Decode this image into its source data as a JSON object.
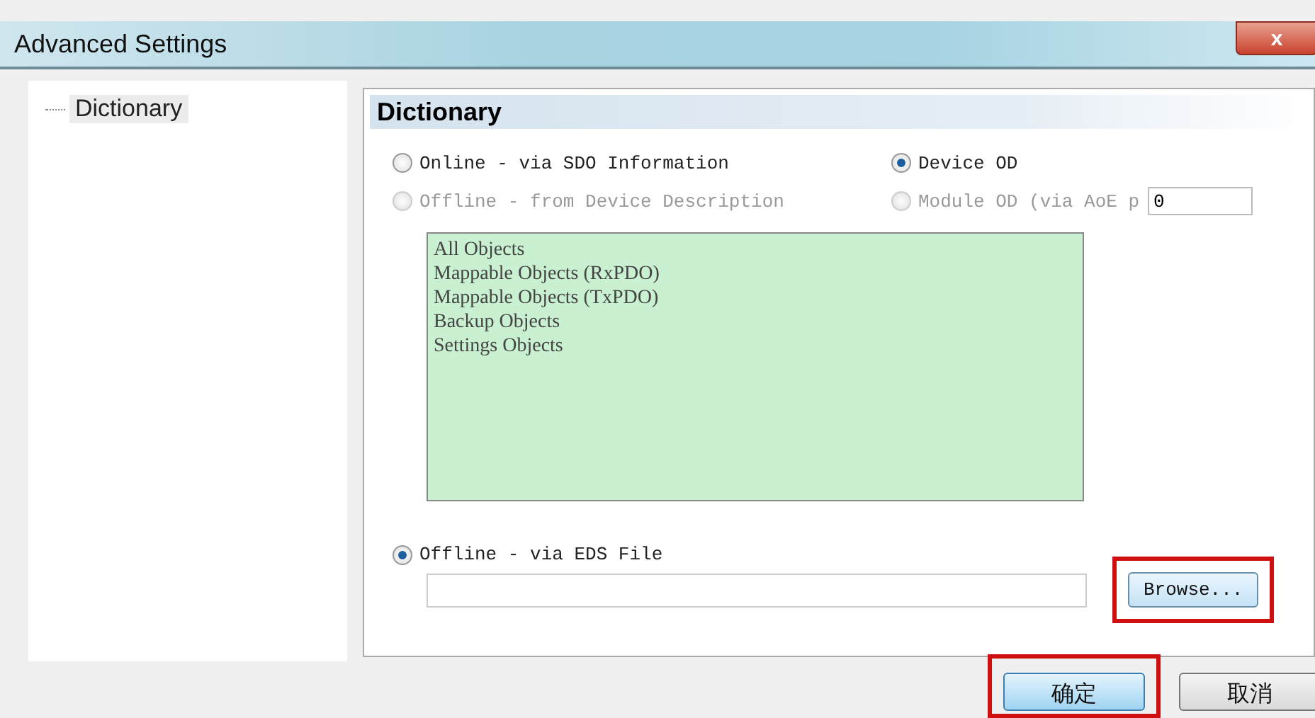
{
  "window": {
    "title": "Advanced Settings",
    "close": "x"
  },
  "tree": {
    "items": [
      {
        "label": "Dictionary",
        "selected": true
      }
    ]
  },
  "panel": {
    "header": "Dictionary",
    "options": [
      {
        "label": "Online - via SDO Information",
        "selected": false,
        "disabled": false
      },
      {
        "label": "Device OD",
        "selected": true,
        "disabled": false
      },
      {
        "label": "Offline - from Device Description",
        "selected": false,
        "disabled": true
      },
      {
        "label": "Module OD (via AoE p",
        "selected": false,
        "disabled": true
      }
    ],
    "module_port": {
      "value": "0"
    },
    "list": [
      "All Objects",
      "Mappable Objects (RxPDO)",
      "Mappable Objects (TxPDO)",
      "Backup Objects",
      "Settings Objects"
    ],
    "eds_option": {
      "label": "Offline - via EDS File",
      "selected": true,
      "disabled": false
    },
    "browse": {
      "label": "Browse...",
      "highlighted": true
    }
  },
  "buttons": [
    {
      "label": "确定",
      "default": true,
      "highlighted": true
    },
    {
      "label": "取消",
      "default": false,
      "highlighted": false
    }
  ]
}
